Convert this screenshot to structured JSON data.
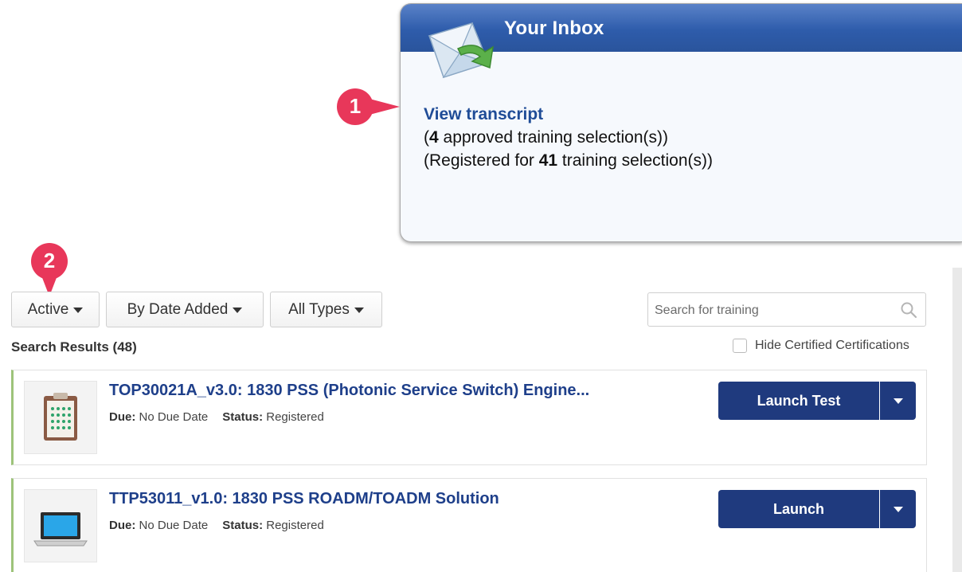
{
  "inbox": {
    "title": "Your Inbox",
    "view_transcript": "View transcript",
    "approved_prefix": "(",
    "approved_count": "4",
    "approved_suffix": " approved training selection(s))",
    "registered_prefix": "(Registered for ",
    "registered_count": "41",
    "registered_suffix": " training selection(s))",
    "icon": "envelope-arrow-icon"
  },
  "markers": [
    {
      "label": "1",
      "color": "#e8375a"
    },
    {
      "label": "2",
      "color": "#e8375a"
    }
  ],
  "filters": {
    "status": "Active",
    "sort": "By Date Added",
    "types": "All Types"
  },
  "search": {
    "placeholder": "Search for training",
    "icon": "search-icon"
  },
  "results": {
    "label": "Search Results (48)",
    "hide_certified": "Hide Certified Certifications"
  },
  "trainings": [
    {
      "title": "TOP30021A_v3.0: 1830 PSS (Photonic Service Switch) Engine...",
      "due_label": "Due:",
      "due_value": "No Due Date",
      "status_label": "Status:",
      "status_value": "Registered",
      "action": "Launch Test",
      "icon": "clipboard-test-icon"
    },
    {
      "title": "TTP53011_v1.0: 1830 PSS ROADM/TOADM Solution",
      "due_label": "Due:",
      "due_value": "No Due Date",
      "status_label": "Status:",
      "status_value": "Registered",
      "action": "Launch",
      "icon": "laptop-icon"
    }
  ],
  "colors": {
    "accent_blue": "#1f3a7e",
    "link_blue": "#1f4c97",
    "card_accent": "#9dc37a",
    "marker": "#e8375a"
  }
}
